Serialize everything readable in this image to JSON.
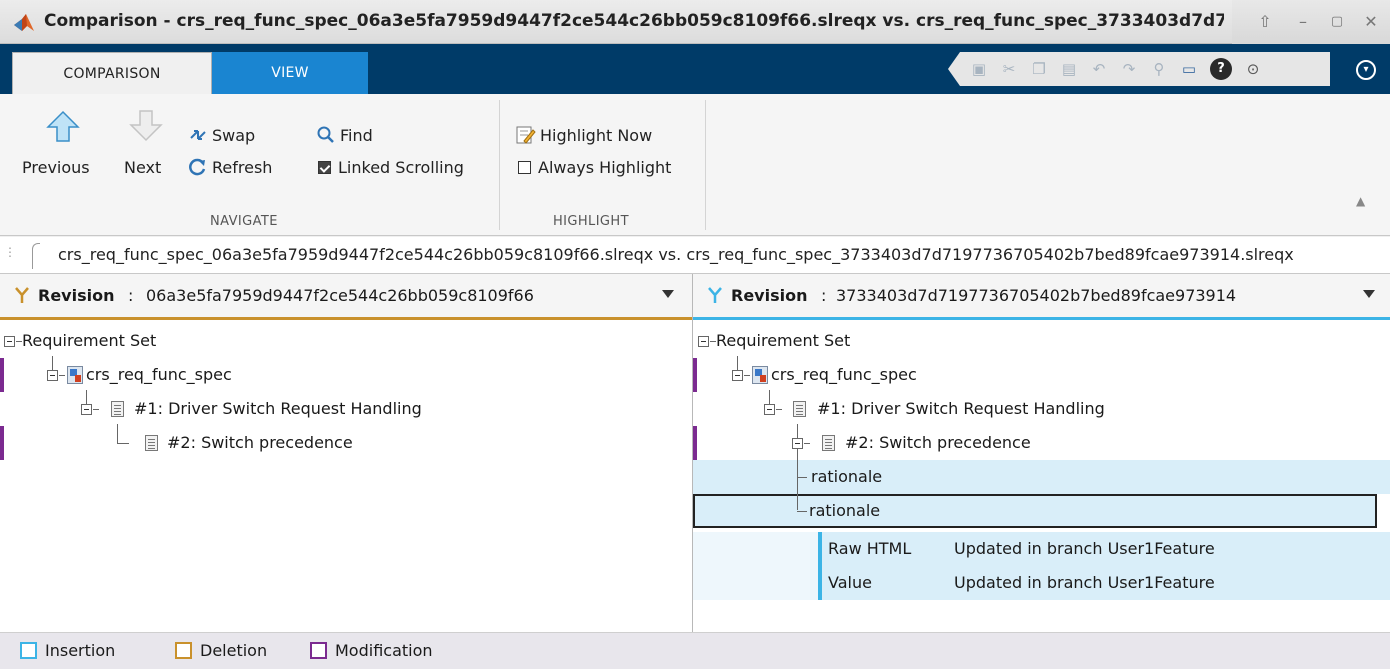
{
  "window": {
    "title": "Comparison - crs_req_func_spec_06a3e5fa7959d9447f2ce544c26bb059c8109f66.slreqx vs. crs_req_func_spec_3733403d7d7197736705402b7bed89fcae973914.slreqx"
  },
  "tabs": [
    "COMPARISON",
    "VIEW"
  ],
  "ribbon": {
    "navigate": {
      "previous": "Previous",
      "next": "Next",
      "swap": "Swap",
      "refresh": "Refresh",
      "find": "Find",
      "linked_scrolling": "Linked Scrolling",
      "label": "NAVIGATE"
    },
    "highlight": {
      "highlight_now": "Highlight Now",
      "always_highlight": "Always Highlight",
      "label": "HIGHLIGHT"
    }
  },
  "path": "crs_req_func_spec_06a3e5fa7959d9447f2ce544c26bb059c8109f66.slreqx vs. crs_req_func_spec_3733403d7d7197736705402b7bed89fcae973914.slreqx",
  "left": {
    "revision_label": "Revision",
    "revision_sep": ":",
    "revision_value": "06a3e5fa7959d9447f2ce544c26bb059c8109f66",
    "tree": {
      "root": "Requirement Set",
      "spec": "crs_req_func_spec",
      "req1": "#1: Driver Switch Request Handling",
      "req2": "#2: Switch precedence"
    }
  },
  "right": {
    "revision_label": "Revision",
    "revision_sep": ":",
    "revision_value": "3733403d7d7197736705402b7bed89fcae973914",
    "tree": {
      "root": "Requirement Set",
      "spec": "crs_req_func_spec",
      "req1": "#1: Driver Switch Request Handling",
      "req2": "#2: Switch precedence",
      "rationale_child": "rationale",
      "rationale_sel": "rationale"
    },
    "properties": [
      {
        "name": "Raw HTML",
        "value": "Updated in branch User1Feature"
      },
      {
        "name": "Value",
        "value": "Updated in branch User1Feature"
      }
    ]
  },
  "legend": {
    "insertion": "Insertion",
    "deletion": "Deletion",
    "modification": "Modification"
  },
  "colors": {
    "insertion": "#3cb4e6",
    "deletion": "#c9912c",
    "modification": "#7b2a90"
  }
}
